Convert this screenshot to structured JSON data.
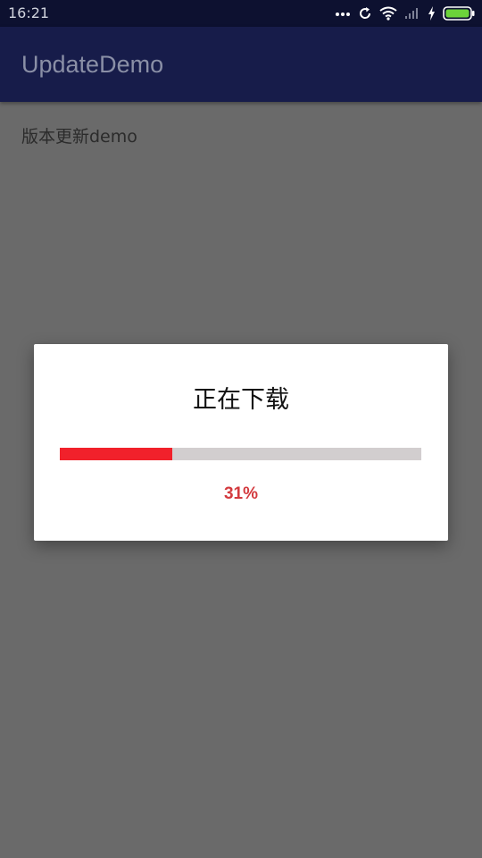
{
  "status_bar": {
    "time": "16:21",
    "icons": [
      "more-dots-icon",
      "sync-icon",
      "wifi-icon",
      "signal-icon",
      "charging-icon",
      "battery-icon"
    ]
  },
  "app_bar": {
    "title": "UpdateDemo"
  },
  "content": {
    "text": "版本更新demo"
  },
  "dialog": {
    "title": "正在下载",
    "progress_fraction": 0.31,
    "progress_label": "31%"
  },
  "colors": {
    "status_bar": "#0d1130",
    "app_bar": "#171c4a",
    "progress_fill": "#f1212b",
    "progress_track": "#d2cecf",
    "progress_text": "#d33a3e",
    "battery_fill": "#6cd33a"
  }
}
